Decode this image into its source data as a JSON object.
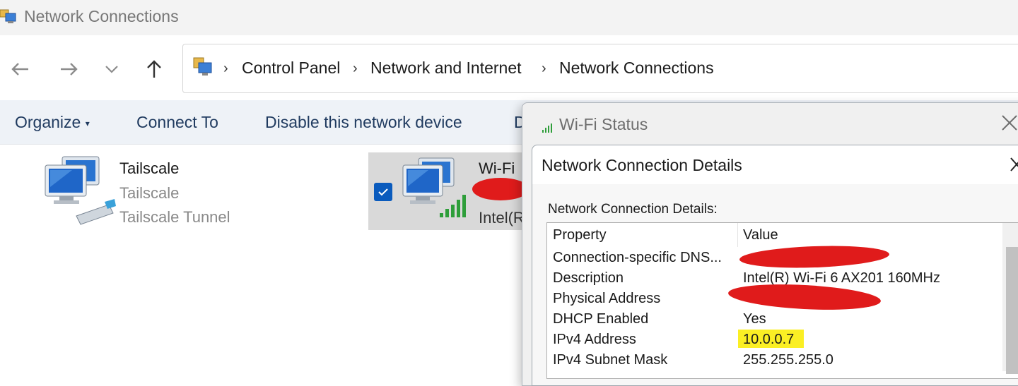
{
  "window": {
    "title": "Network Connections"
  },
  "nav": {
    "back_icon": "back-arrow-icon",
    "forward_icon": "forward-arrow-icon",
    "recent_icon": "chevron-down-icon",
    "up_icon": "up-arrow-icon"
  },
  "breadcrumb": [
    "Control Panel",
    "Network and Internet",
    "Network Connections"
  ],
  "commands": {
    "organize": "Organize",
    "connect_to": "Connect To",
    "disable": "Disable this network device",
    "truncated": "D"
  },
  "connections": [
    {
      "name": "Tailscale",
      "status": "Tailscale",
      "device": "Tailscale Tunnel"
    },
    {
      "name": "Wi-Fi",
      "device": "Intel(R"
    }
  ],
  "status_window": {
    "title": "Wi-Fi Status"
  },
  "details_dialog": {
    "title": "Network Connection Details",
    "list_label": "Network Connection Details:",
    "columns": [
      "Property",
      "Value"
    ],
    "rows": [
      {
        "property": "Connection-specific DNS...",
        "value": ""
      },
      {
        "property": "Description",
        "value": "Intel(R) Wi-Fi 6 AX201 160MHz"
      },
      {
        "property": "Physical Address",
        "value": ""
      },
      {
        "property": "DHCP Enabled",
        "value": "Yes"
      },
      {
        "property": "IPv4 Address",
        "value": "10.0.0.7"
      },
      {
        "property": "IPv4 Subnet Mask",
        "value": "255.255.255.0"
      }
    ]
  },
  "colors": {
    "accent": "#0a5bbd",
    "redaction": "#e01b1b",
    "highlight": "#fbef24",
    "signal": "#2e9e3a"
  }
}
